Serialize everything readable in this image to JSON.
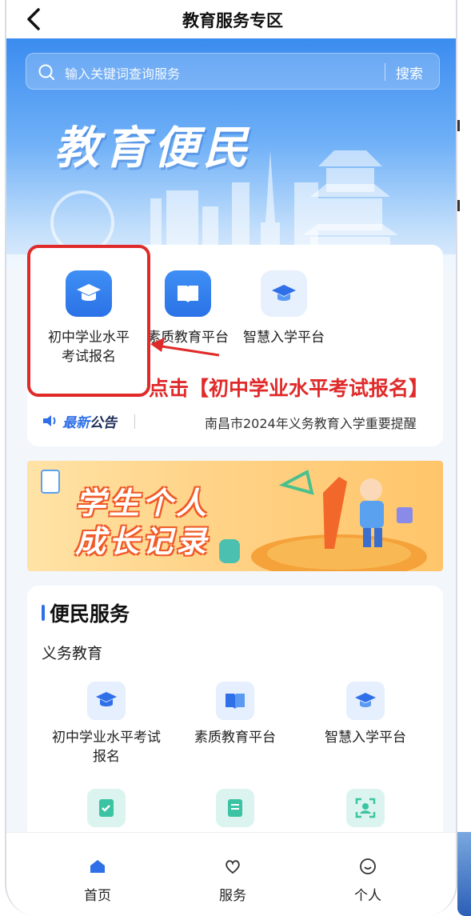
{
  "header": {
    "title": "教育服务专区"
  },
  "search": {
    "placeholder": "输入关键词查询服务",
    "button": "搜索"
  },
  "hero": {
    "title": "教育便民"
  },
  "quick": [
    {
      "label": "初中学业水平\n考试报名",
      "icon": "graduation-cap-icon"
    },
    {
      "label": "素质教育平台",
      "icon": "book-icon"
    },
    {
      "label": "智慧入学平台",
      "icon": "mortarboard-icon"
    }
  ],
  "annotation": "点击【初中学业水平考试报名】",
  "notice": {
    "tag_highlight": "最新",
    "tag_rest": "公告",
    "text": "南昌市2024年义务教育入学重要提醒"
  },
  "banner": {
    "line1": "学生个人",
    "line2": "成长记录"
  },
  "services": {
    "title": "便民服务",
    "subtitle": "义务教育",
    "items": [
      {
        "label": "初中学业水平考试\n报名",
        "icon": "graduation-cap-icon"
      },
      {
        "label": "素质教育平台",
        "icon": "book-icon"
      },
      {
        "label": "智慧入学平台",
        "icon": "mortarboard-icon"
      },
      {
        "label": "",
        "icon": "checklist-icon"
      },
      {
        "label": "",
        "icon": "document-icon"
      },
      {
        "label": "",
        "icon": "face-scan-icon"
      }
    ]
  },
  "nav": [
    {
      "label": "首页",
      "icon": "home-icon"
    },
    {
      "label": "服务",
      "icon": "heart-icon"
    },
    {
      "label": "个人",
      "icon": "smile-icon"
    }
  ],
  "colors": {
    "primary": "#2f6fe8",
    "annotation": "#e02a2a",
    "hero_top": "#3b8cf0"
  }
}
